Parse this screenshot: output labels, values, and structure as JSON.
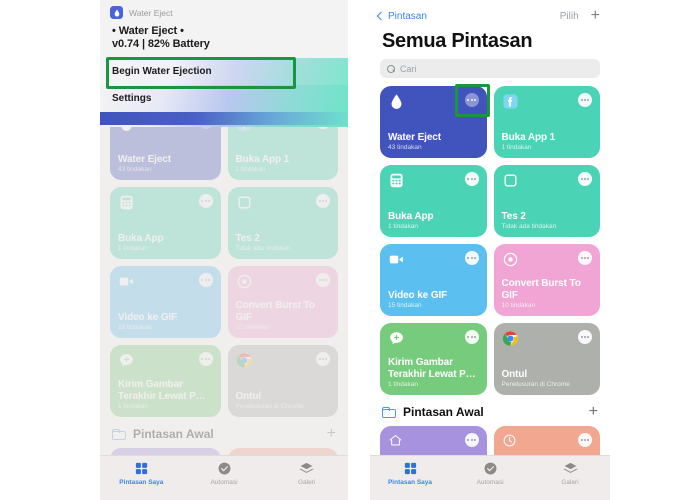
{
  "left_panel": {
    "widget": {
      "app_icon": "water-drop-icon",
      "app_name": "Water Eject",
      "line1": "• Water Eject •",
      "line2": "v0.74 | 82% Battery",
      "rows": [
        {
          "label": "Begin Water Ejection",
          "highlighted": true
        },
        {
          "label": "Settings",
          "highlighted": false
        }
      ]
    }
  },
  "right_panel": {
    "nav": {
      "back_label": "Pintasan",
      "back_icon": "chevron-left-icon",
      "select_label": "Pilih",
      "add_icon": "plus-icon"
    },
    "title": "Semua Pintasan",
    "search": {
      "icon": "search-icon",
      "placeholder": "Cari",
      "value": ""
    }
  },
  "shortcuts": [
    {
      "name": "Water Eject",
      "subtitle": "43 tindakan",
      "color": "#4154bd",
      "css": "c-indigo",
      "icon": "water-drop-icon",
      "more_pressed": true
    },
    {
      "name": "Buka App 1",
      "subtitle": "1 tindakan",
      "color": "#4ad3b4",
      "css": "c-mint",
      "icon": "facebook-icon",
      "more_pressed": false
    },
    {
      "name": "Buka App",
      "subtitle": "1 tindakan",
      "color": "#4ad3b4",
      "css": "c-mint",
      "icon": "calculator-icon",
      "more_pressed": false
    },
    {
      "name": "Tes 2",
      "subtitle": "Tidak ada tindakan",
      "color": "#4ad3b4",
      "css": "c-mint",
      "icon": "square-icon",
      "more_pressed": false
    },
    {
      "name": "Video ke GIF",
      "subtitle": "15 tindakan",
      "color": "#5bc0f0",
      "css": "c-blue",
      "icon": "video-camera-icon",
      "more_pressed": false
    },
    {
      "name": "Convert Burst To GIF",
      "subtitle": "10 tindakan",
      "color": "#f0a5d4",
      "css": "c-pink",
      "icon": "camera-icon",
      "more_pressed": false
    },
    {
      "name": "Kirim Gambar Terakhir Lewat P…",
      "subtitle": "1 tindakan",
      "color": "#76cc7c",
      "css": "c-green",
      "icon": "message-plus-icon",
      "more_pressed": false
    },
    {
      "name": "Ontul",
      "subtitle": "Penelusuran di Chrome",
      "color": "#aeb0ab",
      "css": "c-gray",
      "icon": "chrome-icon",
      "more_pressed": false
    }
  ],
  "folder": {
    "icon": "folder-icon",
    "name": "Pintasan Awal",
    "add_icon": "plus-icon",
    "cards": [
      {
        "color": "#a692de",
        "css": "c-purple",
        "icon": "home-icon"
      },
      {
        "color": "#f2a791",
        "css": "c-peach",
        "icon": "clock-icon"
      }
    ]
  },
  "tabbar": {
    "tabs": [
      {
        "label": "Pintasan Saya",
        "icon": "grid-squares-icon",
        "active": true
      },
      {
        "label": "Automasi",
        "icon": "automation-icon",
        "active": false
      },
      {
        "label": "Galeri",
        "icon": "stack-layers-icon",
        "active": false
      }
    ]
  },
  "annotations": {
    "highlight_color": "#1a9641",
    "boxes": [
      {
        "name": "begin-water-ejection-highlight"
      },
      {
        "name": "more-button-highlight"
      }
    ]
  }
}
